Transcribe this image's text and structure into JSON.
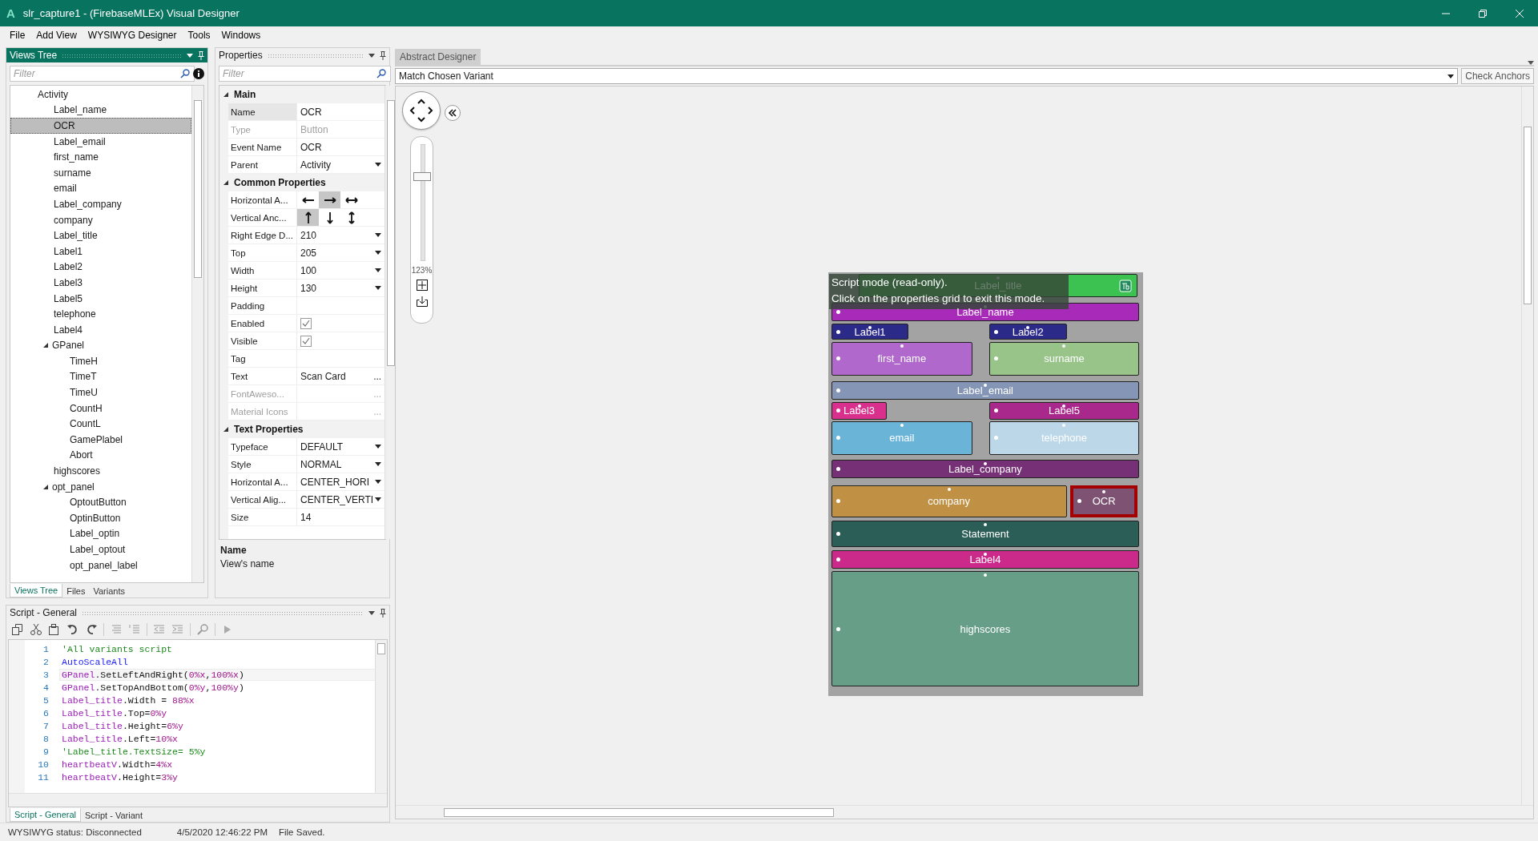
{
  "window": {
    "logo": "A",
    "title": "slr_capture1 - (FirebaseMLEx) Visual Designer"
  },
  "menu": [
    "File",
    "Add View",
    "WYSIWYG Designer",
    "Tools",
    "Windows"
  ],
  "views_tree": {
    "title": "Views Tree",
    "placeholder": "Filter",
    "items": [
      {
        "label": "Activity",
        "selected": false,
        "children": [
          {
            "label": "Label_name",
            "selected": false
          },
          {
            "label": "OCR",
            "selected": true
          },
          {
            "label": "Label_email",
            "selected": false
          },
          {
            "label": "first_name",
            "selected": false
          },
          {
            "label": "surname",
            "selected": false
          },
          {
            "label": "email",
            "selected": false
          },
          {
            "label": "Label_company",
            "selected": false
          },
          {
            "label": "company",
            "selected": false
          },
          {
            "label": "Label_title",
            "selected": false
          },
          {
            "label": "Label1",
            "selected": false
          },
          {
            "label": "Label2",
            "selected": false
          },
          {
            "label": "Label3",
            "selected": false
          },
          {
            "label": "Label5",
            "selected": false
          },
          {
            "label": "telephone",
            "selected": false
          },
          {
            "label": "Label4",
            "selected": false
          },
          {
            "label": "GPanel",
            "selected": false,
            "expanded": true,
            "children": [
              {
                "label": "TimeH",
                "selected": false
              },
              {
                "label": "TimeT",
                "selected": false
              },
              {
                "label": "TimeU",
                "selected": false
              },
              {
                "label": "CountH",
                "selected": false
              },
              {
                "label": "CountL",
                "selected": false
              },
              {
                "label": "GamePlabel",
                "selected": false
              },
              {
                "label": "Abort",
                "selected": false
              }
            ]
          },
          {
            "label": "highscores",
            "selected": false
          },
          {
            "label": "opt_panel",
            "selected": false,
            "expanded": true,
            "children": [
              {
                "label": "OptoutButton",
                "selected": false
              },
              {
                "label": "OptinButton",
                "selected": false
              },
              {
                "label": "Label_optin",
                "selected": false
              },
              {
                "label": "Label_optout",
                "selected": false
              },
              {
                "label": "opt_panel_label",
                "selected": false
              }
            ]
          }
        ]
      }
    ],
    "tabs": [
      {
        "label": "Views Tree",
        "selected": true
      },
      {
        "label": "Files",
        "selected": false
      },
      {
        "label": "Variants",
        "selected": false
      }
    ]
  },
  "properties": {
    "title": "Properties",
    "placeholder": "Filter",
    "categories": [
      {
        "name": "Main",
        "expanded": true,
        "rows": [
          {
            "kind": "text",
            "name": "Name",
            "value": "OCR",
            "disabled": false,
            "selected": true
          },
          {
            "kind": "text",
            "name": "Type",
            "value": "Button",
            "disabled": true,
            "selected": false
          },
          {
            "kind": "text",
            "name": "Event Name",
            "value": "OCR",
            "disabled": false,
            "selected": false
          },
          {
            "kind": "dropdown",
            "name": "Parent",
            "value": "Activity",
            "disabled": false,
            "selected": false
          }
        ]
      },
      {
        "name": "Common Properties",
        "expanded": true,
        "rows": [
          {
            "kind": "h_anchor",
            "name": "Horizontal A...",
            "disabled": false,
            "selected": false,
            "options": [
              {
                "selected": false
              },
              {
                "selected": true
              },
              {
                "selected": false
              }
            ]
          },
          {
            "kind": "v_anchor",
            "name": "Vertical Anc...",
            "disabled": false,
            "selected": false,
            "options": [
              {
                "selected": true
              },
              {
                "selected": false
              },
              {
                "selected": false
              }
            ]
          },
          {
            "kind": "dropdown",
            "name": "Right Edge D...",
            "value": "210",
            "disabled": false,
            "selected": false
          },
          {
            "kind": "dropdown",
            "name": "Top",
            "value": "205",
            "disabled": false,
            "selected": false
          },
          {
            "kind": "dropdown",
            "name": "Width",
            "value": "100",
            "disabled": false,
            "selected": false
          },
          {
            "kind": "dropdown",
            "name": "Height",
            "value": "130",
            "disabled": false,
            "selected": false
          },
          {
            "kind": "text",
            "name": "Padding",
            "disabled": false,
            "selected": false
          },
          {
            "kind": "checkbox",
            "name": "Enabled",
            "checked": true,
            "disabled": false,
            "selected": false
          },
          {
            "kind": "checkbox",
            "name": "Visible",
            "checked": true,
            "disabled": false,
            "selected": false
          },
          {
            "kind": "text",
            "name": "Tag",
            "disabled": false,
            "selected": false
          },
          {
            "kind": "ellipsis",
            "name": "Text",
            "value": "Scan Card",
            "button": "...",
            "disabled": false,
            "selected": false
          },
          {
            "kind": "ellipsis",
            "name": "FontAweso...",
            "button": "...",
            "disabled": true,
            "selected": false
          },
          {
            "kind": "ellipsis",
            "name": "Material Icons",
            "button": "...",
            "disabled": true,
            "selected": false
          }
        ]
      },
      {
        "name": "Text Properties",
        "expanded": true,
        "rows": [
          {
            "kind": "dropdown",
            "name": "Typeface",
            "value": "DEFAULT",
            "disabled": false,
            "selected": false
          },
          {
            "kind": "dropdown",
            "name": "Style",
            "value": "NORMAL",
            "disabled": false,
            "selected": false
          },
          {
            "kind": "dropdown",
            "name": "Horizontal A...",
            "value": "CENTER_HORI",
            "disabled": false,
            "selected": false
          },
          {
            "kind": "dropdown",
            "name": "Vertical Alig...",
            "value": "CENTER_VERTI",
            "disabled": false,
            "selected": false
          },
          {
            "kind": "text",
            "name": "Size",
            "value": "14",
            "disabled": false,
            "selected": false
          }
        ]
      }
    ],
    "description": {
      "title": "Name",
      "text": "View's name"
    }
  },
  "script": {
    "title": "Script - General",
    "lines": [
      {
        "number": "1",
        "current": false,
        "tokens": [
          {
            "kind": "comment",
            "text": "'All variants script"
          }
        ]
      },
      {
        "number": "2",
        "current": false,
        "tokens": [
          {
            "kind": "keyword",
            "text": "AutoScaleAll"
          }
        ]
      },
      {
        "number": "3",
        "current": true,
        "tokens": [
          {
            "kind": "object",
            "text": "GPanel"
          },
          {
            "kind": "plain",
            "text": ".SetLeftAndRight("
          },
          {
            "kind": "number",
            "text": "0%x"
          },
          {
            "kind": "plain",
            "text": ","
          },
          {
            "kind": "number",
            "text": "100%x"
          },
          {
            "kind": "plain",
            "text": ")"
          }
        ]
      },
      {
        "number": "4",
        "current": false,
        "tokens": [
          {
            "kind": "object",
            "text": "GPanel"
          },
          {
            "kind": "plain",
            "text": ".SetTopAndBottom("
          },
          {
            "kind": "number",
            "text": "0%y"
          },
          {
            "kind": "plain",
            "text": ","
          },
          {
            "kind": "number",
            "text": "100%y"
          },
          {
            "kind": "plain",
            "text": ")"
          }
        ]
      },
      {
        "number": "5",
        "current": false,
        "tokens": [
          {
            "kind": "object",
            "text": "Label_title"
          },
          {
            "kind": "plain",
            "text": ".Width = "
          },
          {
            "kind": "number",
            "text": "88%x"
          }
        ]
      },
      {
        "number": "6",
        "current": false,
        "tokens": [
          {
            "kind": "object",
            "text": "Label_title"
          },
          {
            "kind": "plain",
            "text": ".Top="
          },
          {
            "kind": "number",
            "text": "0%y"
          }
        ]
      },
      {
        "number": "7",
        "current": false,
        "tokens": [
          {
            "kind": "object",
            "text": "Label_title"
          },
          {
            "kind": "plain",
            "text": ".Height="
          },
          {
            "kind": "number",
            "text": "6%y"
          }
        ]
      },
      {
        "number": "8",
        "current": false,
        "tokens": [
          {
            "kind": "object",
            "text": "Label_title"
          },
          {
            "kind": "plain",
            "text": ".Left="
          },
          {
            "kind": "number",
            "text": "10%x"
          }
        ]
      },
      {
        "number": "9",
        "current": false,
        "tokens": [
          {
            "kind": "comment",
            "text": "'Label_title.TextSize= 5%y"
          }
        ]
      },
      {
        "number": "10",
        "current": false,
        "tokens": [
          {
            "kind": "object",
            "text": "heartbeatV"
          },
          {
            "kind": "plain",
            "text": ".Width="
          },
          {
            "kind": "number",
            "text": "4%x"
          }
        ]
      },
      {
        "number": "11",
        "current": false,
        "tokens": [
          {
            "kind": "object",
            "text": "heartbeatV"
          },
          {
            "kind": "plain",
            "text": ".Height="
          },
          {
            "kind": "number",
            "text": "3%y"
          }
        ]
      }
    ],
    "tabs": [
      {
        "label": "Script - General",
        "selected": true
      },
      {
        "label": "Script - Variant",
        "selected": false
      }
    ]
  },
  "designer": {
    "tab": "Abstract Designer",
    "variant": "Match Chosen Variant",
    "check_button": "Check Anchors",
    "zoom": {
      "level": 0.74,
      "reading": "123%"
    },
    "notice": [
      "Script mode (read-only).",
      "Click on the properties grid to exit this mode."
    ],
    "views": [
      {
        "label": "Label_title",
        "color": "#3cc250",
        "selected": false
      },
      {
        "label": "Label_name",
        "color": "#a82ab8",
        "selected": false
      },
      {
        "label": "Label1",
        "color": "#2c2a88",
        "selected": false
      },
      {
        "label": "Label2",
        "color": "#2c2a88",
        "selected": false
      },
      {
        "label": "first_name",
        "color": "#b068cc",
        "selected": false
      },
      {
        "label": "surname",
        "color": "#98c48a",
        "selected": false
      },
      {
        "label": "Label_email",
        "color": "#8595b5",
        "selected": false
      },
      {
        "label": "Label3",
        "color": "#d8308c",
        "selected": false
      },
      {
        "label": "Label5",
        "color": "#a8288c",
        "selected": false
      },
      {
        "label": "email",
        "color": "#6ab4d8",
        "selected": false
      },
      {
        "label": "telephone",
        "color": "#bcd8e8",
        "selected": false
      },
      {
        "label": "Label_company",
        "color": "#763076",
        "selected": false
      },
      {
        "label": "company",
        "color": "#c09045",
        "selected": false
      },
      {
        "label": "OCR",
        "color": "#7e5272",
        "selected": true
      },
      {
        "label": "Statement",
        "color": "#2c5e58",
        "selected": false
      },
      {
        "label": "Label4",
        "color": "#cc2a8a",
        "selected": false
      },
      {
        "label": "highscores",
        "color": "#679e88",
        "selected": false
      }
    ]
  },
  "status_bar": [
    "WYSIWYG status: Disconnected",
    "4/5/2020 12:46:22 PM",
    "File Saved."
  ]
}
